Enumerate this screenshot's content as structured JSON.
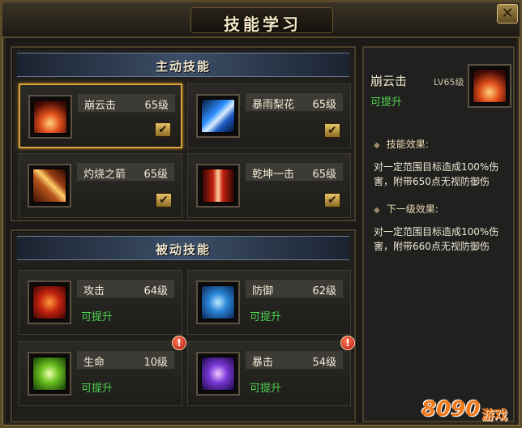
{
  "window": {
    "title": "技能学习",
    "close_label": "✕"
  },
  "active_panel": {
    "header": "主动技能",
    "skills": [
      {
        "name": "崩云击",
        "level": "65级",
        "icon": "beng-yun-ji-icon",
        "checked": "✔"
      },
      {
        "name": "暴雨梨花",
        "level": "65级",
        "icon": "bao-yu-li-hua-icon",
        "checked": "✔"
      },
      {
        "name": "灼烧之箭",
        "level": "65级",
        "icon": "zhuo-shao-zhi-jian-icon",
        "checked": "✔"
      },
      {
        "name": "乾坤一击",
        "level": "65级",
        "icon": "qian-kun-yi-ji-icon",
        "checked": "✔"
      }
    ]
  },
  "passive_panel": {
    "header": "被动技能",
    "skills": [
      {
        "name": "攻击",
        "level": "64级",
        "status": "可提升",
        "icon": "attack-icon"
      },
      {
        "name": "防御",
        "level": "62级",
        "status": "可提升",
        "icon": "defense-icon"
      },
      {
        "name": "生命",
        "level": "10级",
        "status": "可提升",
        "icon": "life-icon",
        "alert": "!"
      },
      {
        "name": "暴击",
        "level": "54级",
        "status": "可提升",
        "icon": "crit-icon",
        "alert": "!"
      }
    ]
  },
  "detail": {
    "name": "崩云击",
    "level": "LV65级",
    "status": "可提升",
    "effect_title": "技能效果:",
    "effect_text": "对一定范围目标造成100%伤害，附带650点无视防御伤",
    "next_title": "下一级效果:",
    "next_text": "对一定范围目标造成100%伤害，附带660点无视防御伤"
  },
  "watermark": {
    "number": "8090",
    "text": "游戏"
  },
  "colors": {
    "accent_gold": "#d9a23a",
    "upgrade_green": "#4fd34f",
    "alert_red": "#b3140a"
  }
}
